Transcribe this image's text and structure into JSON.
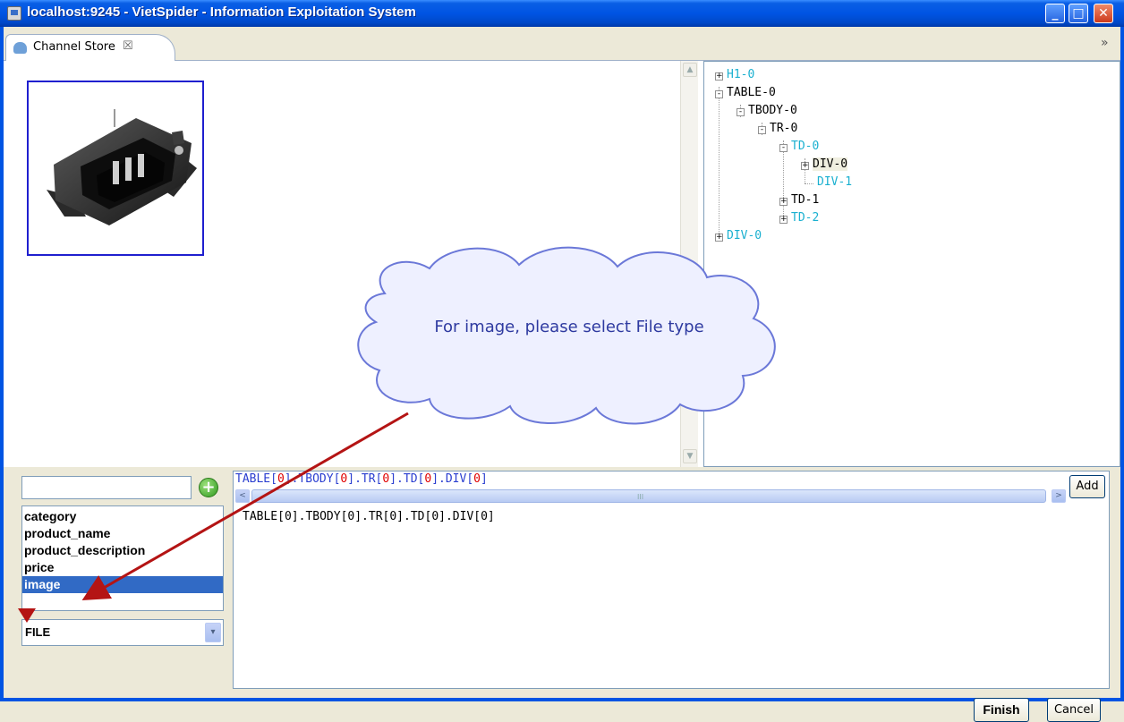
{
  "window": {
    "title": "localhost:9245 - VietSpider - Information Exploitation System",
    "controls": {
      "minimize": "_",
      "maximize": "□",
      "close": "✕"
    }
  },
  "tab": {
    "label": "Channel Store",
    "close_glyph": "☒",
    "more_glyph": "»"
  },
  "preview": {
    "image_description": "product-image",
    "image_icon": "power-socket"
  },
  "tree": {
    "nodes": [
      {
        "label": "H1-0",
        "toggle": "+",
        "color": "cyan"
      },
      {
        "label": "TABLE-0",
        "toggle": "-",
        "color": "dark"
      },
      {
        "label": "TBODY-0",
        "toggle": "-",
        "color": "dark"
      },
      {
        "label": "TR-0",
        "toggle": "-",
        "color": "dark"
      },
      {
        "label": "TD-0",
        "toggle": "-",
        "color": "cyan"
      },
      {
        "label": "DIV-0",
        "toggle": "+",
        "color": "dark",
        "selected": true
      },
      {
        "label": "DIV-1",
        "toggle": "",
        "color": "cyan"
      },
      {
        "label": "TD-1",
        "toggle": "+",
        "color": "dark"
      },
      {
        "label": "TD-2",
        "toggle": "+",
        "color": "cyan"
      },
      {
        "label": "DIV-0",
        "toggle": "+",
        "color": "cyan"
      }
    ]
  },
  "fields": {
    "new_field_value": "",
    "add_icon": "+",
    "items": [
      "category",
      "product_name",
      "product_description",
      "price",
      "image"
    ],
    "selected_index": 4,
    "type_value": "FILE",
    "dropdown_glyph": "▾"
  },
  "xpath": {
    "segments": [
      {
        "text": "TABLE[",
        "red": false
      },
      {
        "text": "0",
        "red": true
      },
      {
        "text": "].TBODY[",
        "red": false
      },
      {
        "text": "0",
        "red": true
      },
      {
        "text": "].TR[",
        "red": false
      },
      {
        "text": "0",
        "red": true
      },
      {
        "text": "].TD[",
        "red": false
      },
      {
        "text": "0",
        "red": true
      },
      {
        "text": "].DIV[",
        "red": false
      },
      {
        "text": "0",
        "red": true
      },
      {
        "text": "]",
        "red": false
      }
    ],
    "add_label": "Add",
    "result": "TABLE[0].TBODY[0].TR[0].TD[0].DIV[0]",
    "scroll_left": "<",
    "scroll_right": ">",
    "grip": "III"
  },
  "footer": {
    "finish_label": "Finish",
    "cancel_label": "Cancel"
  },
  "annotation": {
    "callout_text": "For image, please select File type",
    "arrow_color": "#B41414",
    "cloud_stroke": "#6B78D8",
    "cloud_fill": "#EEF0FF"
  }
}
